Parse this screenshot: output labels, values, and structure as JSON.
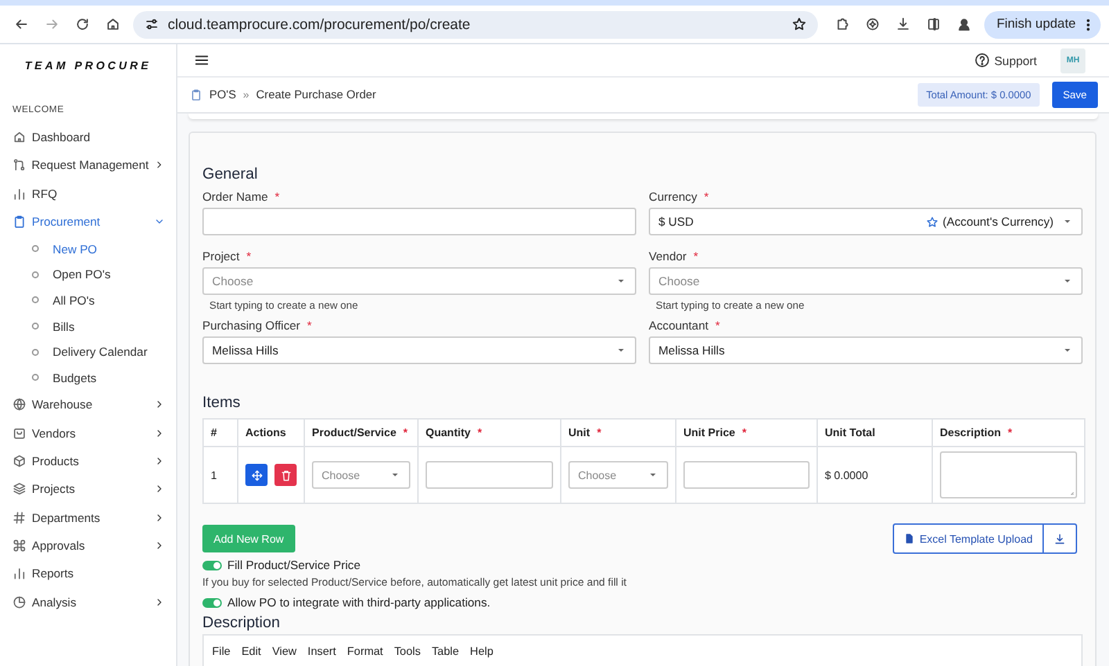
{
  "browser": {
    "url": "cloud.teamprocure.com/procurement/po/create",
    "update_button": "Finish update"
  },
  "sidebar": {
    "logo": "TEAM PROCURE",
    "section": "WELCOME",
    "items": [
      {
        "label": "Dashboard",
        "selected": false
      },
      {
        "label": "Request Management",
        "selected": false,
        "expanded": false
      },
      {
        "label": "RFQ",
        "selected": false
      },
      {
        "label": "Procurement",
        "selected": true,
        "expanded": true,
        "children": [
          {
            "label": "New PO",
            "selected": true
          },
          {
            "label": "Open PO's",
            "selected": false
          },
          {
            "label": "All PO's",
            "selected": false
          },
          {
            "label": "Bills",
            "selected": false
          },
          {
            "label": "Delivery Calendar",
            "selected": false
          },
          {
            "label": "Budgets",
            "selected": false
          }
        ]
      },
      {
        "label": "Warehouse",
        "selected": false,
        "expanded": false
      },
      {
        "label": "Vendors",
        "selected": false,
        "expanded": false
      },
      {
        "label": "Products",
        "selected": false,
        "expanded": false
      },
      {
        "label": "Projects",
        "selected": false,
        "expanded": false
      },
      {
        "label": "Departments",
        "selected": false,
        "expanded": false
      },
      {
        "label": "Approvals",
        "selected": false,
        "expanded": false
      },
      {
        "label": "Reports",
        "selected": false
      },
      {
        "label": "Analysis",
        "selected": false,
        "expanded": false
      }
    ]
  },
  "header": {
    "support": "Support",
    "avatar": "MH"
  },
  "breadcrumb": {
    "items": [
      "PO'S",
      "Create Purchase Order"
    ],
    "separator": "»",
    "total": "Total Amount: $ 0.0000",
    "save_button": "Save"
  },
  "general": {
    "title": "General",
    "fields": [
      {
        "label": "Order Name",
        "required_mark": "*",
        "kind": "input"
      },
      {
        "label": "Currency",
        "required_mark": "*",
        "kind": "select",
        "value": "$ USD",
        "note": "(Account's Currency)"
      },
      {
        "label": "Project",
        "required_mark": "*",
        "kind": "select",
        "placeholder": "Choose",
        "hint": "Start typing to create a new one"
      },
      {
        "label": "Vendor",
        "required_mark": "*",
        "kind": "select",
        "placeholder": "Choose",
        "hint": "Start typing to create a new one"
      },
      {
        "label": "Purchasing Officer",
        "required_mark": "*",
        "kind": "select",
        "value": "Melissa Hills"
      },
      {
        "label": "Accountant",
        "required_mark": "*",
        "kind": "select",
        "value": "Melissa Hills"
      }
    ]
  },
  "items": {
    "title": "Items",
    "columns": [
      {
        "label": "#"
      },
      {
        "label": "Actions"
      },
      {
        "label": "Product/Service",
        "required_mark": "*"
      },
      {
        "label": "Quantity",
        "required_mark": "*"
      },
      {
        "label": "Unit",
        "required_mark": "*"
      },
      {
        "label": "Unit Price",
        "required_mark": "*"
      },
      {
        "label": "Unit Total"
      },
      {
        "label": "Description",
        "required_mark": "*"
      }
    ],
    "rows": [
      {
        "number": "1",
        "product_placeholder": "Choose",
        "unit_placeholder": "Choose",
        "unit_total": "$ 0.0000"
      }
    ],
    "add_row_button": "Add New Row",
    "excel_button": "Excel Template Upload"
  },
  "options": [
    {
      "label": "Fill Product/Service Price",
      "on": true,
      "hint": "If you buy for selected Product/Service before, automatically get latest unit price and fill it"
    },
    {
      "label": "Allow PO to integrate with third-party applications.",
      "on": true
    }
  ],
  "description": {
    "title": "Description",
    "menu": [
      "File",
      "Edit",
      "View",
      "Insert",
      "Format",
      "Tools",
      "Table",
      "Help"
    ]
  }
}
